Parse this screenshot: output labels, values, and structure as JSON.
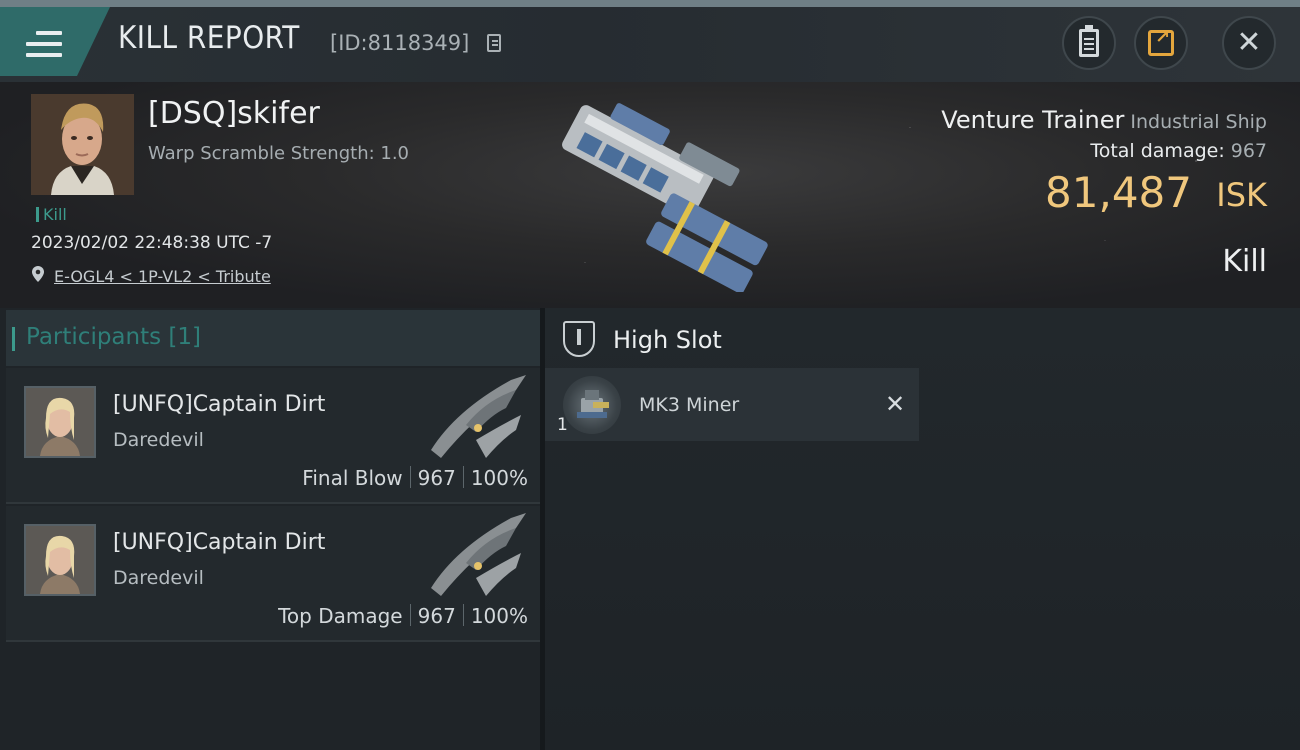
{
  "header": {
    "title": "KILL REPORT",
    "report_id": "[ID:8118349]",
    "icons": {
      "menu": "menu-icon",
      "copy": "copy-icon",
      "clipboard": "clipboard-icon",
      "share": "share-icon",
      "close": "close-icon"
    },
    "close_glyph": "✕"
  },
  "victim": {
    "pilot": "[DSQ]skifer",
    "scramble": "Warp Scramble Strength: 1.0",
    "kill_tag": "Kill",
    "timestamp": "2023/02/02 22:48:38 UTC -7",
    "location": "E-OGL4 < 1P-VL2 < Tribute",
    "ship_name": "Venture Trainer",
    "ship_class": "Industrial Ship",
    "total_damage_label": "Total damage:",
    "total_damage": "967",
    "isk_value": "81,487",
    "isk_unit": "ISK",
    "result": "Kill"
  },
  "participants": {
    "title": "Participants",
    "count": "[1]",
    "rows": [
      {
        "name": "[UNFQ]Captain Dirt",
        "ship": "Daredevil",
        "tag": "Final Blow",
        "damage": "967",
        "percent": "100%"
      },
      {
        "name": "[UNFQ]Captain Dirt",
        "ship": "Daredevil",
        "tag": "Top Damage",
        "damage": "967",
        "percent": "100%"
      }
    ]
  },
  "fittings": {
    "section": "High Slot",
    "modules": [
      {
        "qty": "1",
        "name": "MK3 Miner",
        "remove": "✕"
      }
    ]
  },
  "colors": {
    "accent_teal": "#3c9a8c",
    "isk_gold": "#f0c77d",
    "share_orange": "#e4a63d"
  }
}
